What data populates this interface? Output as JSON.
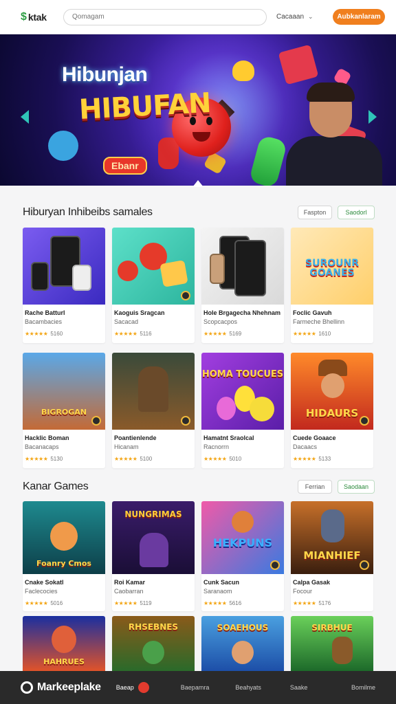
{
  "header": {
    "logo_mark": "$",
    "logo_text": "ktak",
    "search_placeholder": "Qomagam",
    "lang_label": "Cacaaan",
    "cta_label": "Aubkanlaram"
  },
  "hero": {
    "title": "Hibunjan",
    "subtitle": "HIBUFAN",
    "badge": "Ebanr"
  },
  "sections": [
    {
      "title": "Hiburyan Inhibeibs samales",
      "pill_1": "Faspton",
      "pill_2": "Saodorl",
      "cards": [
        {
          "title": "Rache Batturl",
          "sub": "Bacambacies",
          "rating": "5160",
          "thumb_text": ""
        },
        {
          "title": "Kaoguis Sragcan",
          "sub": "Sacacad",
          "rating": "5116",
          "thumb_text": ""
        },
        {
          "title": "Hole Brgagecha Nhehnam",
          "sub": "Scopcacpos",
          "rating": "5169",
          "thumb_text": ""
        },
        {
          "title": "Foclic Gavuh",
          "sub": "Farmeche Bhellinn",
          "rating": "1610",
          "thumb_text": "SUROUNR GOANES"
        },
        {
          "title": "Hacklic Boman",
          "sub": "Bacanacaps",
          "rating": "5130",
          "thumb_text": "BIGROGAN"
        },
        {
          "title": "Poantienlende",
          "sub": "Hicanam",
          "rating": "5100",
          "thumb_text": ""
        },
        {
          "title": "Hamatnt Sraolcal",
          "sub": "Racnorrn",
          "rating": "5010",
          "thumb_text": "HOMA TOUCUES"
        },
        {
          "title": "Cuede Goaace",
          "sub": "Dacaacs",
          "rating": "5133",
          "thumb_text": "HIDAURS"
        }
      ]
    },
    {
      "title": "Kanar Games",
      "pill_1": "Ferrian",
      "pill_2": "Saodaan",
      "cards": [
        {
          "title": "Cnake Sokatl",
          "sub": "Faclecocies",
          "rating": "5016",
          "thumb_text": "Foanry Cmos"
        },
        {
          "title": "Roi Kamar",
          "sub": "Caobarran",
          "rating": "5119",
          "thumb_text": "NUNGRIMAS"
        },
        {
          "title": "Cunk Sacun",
          "sub": "Saranaom",
          "rating": "5616",
          "thumb_text": "HEKPUNS"
        },
        {
          "title": "Calpa Gasak",
          "sub": "Focour",
          "rating": "5176",
          "thumb_text": "MIANHIEF"
        },
        {
          "title": "",
          "sub": "",
          "rating": "",
          "thumb_text": "HAHRUES"
        },
        {
          "title": "",
          "sub": "",
          "rating": "",
          "thumb_text": "RHSEBNES"
        },
        {
          "title": "",
          "sub": "",
          "rating": "",
          "thumb_text": "SOAEHOUS"
        },
        {
          "title": "",
          "sub": "",
          "rating": "",
          "thumb_text": "SIRBHUE"
        }
      ]
    }
  ],
  "footer": {
    "brand": "Markeeplake",
    "bean_label": "Baeap",
    "links": [
      "Baepamra",
      "Beahyats",
      "Saake",
      "Bomilme"
    ]
  },
  "stars": "★★★★★"
}
